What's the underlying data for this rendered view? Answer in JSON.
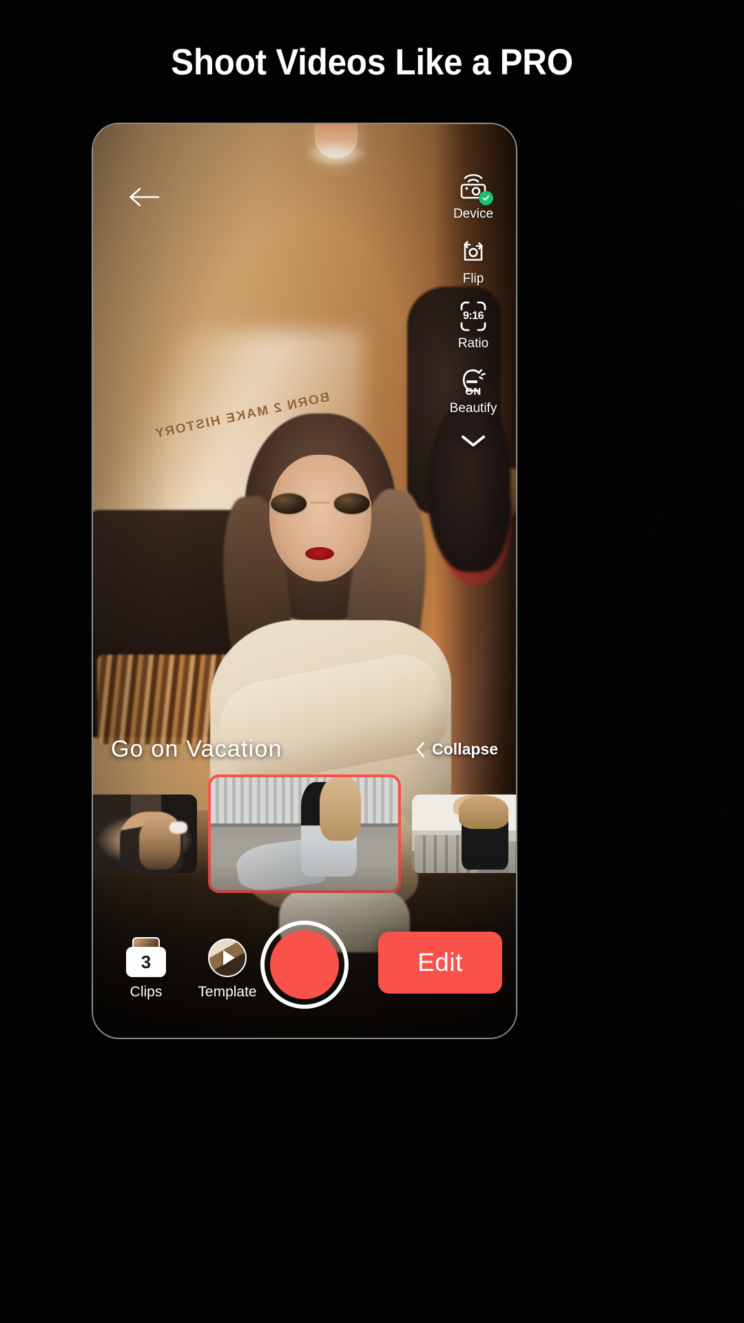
{
  "headline": "Shoot Videos Like a PRO",
  "phone": {
    "back_icon": "back-arrow-icon",
    "rail": [
      {
        "icon": "camera-device-icon",
        "label": "Device",
        "badge": "check-badge",
        "state": "connected"
      },
      {
        "icon": "camera-flip-icon",
        "label": "Flip"
      },
      {
        "icon": "aspect-ratio-icon",
        "label": "Ratio",
        "value": "9:16"
      },
      {
        "icon": "beautify-face-icon",
        "label": "Beautify",
        "value": "ON"
      }
    ],
    "rail_collapse_icon": "chevron-down-icon",
    "template": {
      "title": "Go on Vacation",
      "collapse_label": "Collapse",
      "collapse_icon": "chevron-left-icon",
      "thumbnails": [
        {
          "name": "clip-thumbnail-1",
          "selected": false
        },
        {
          "name": "clip-thumbnail-2",
          "selected": true
        },
        {
          "name": "clip-thumbnail-3",
          "selected": false
        }
      ]
    },
    "bottom_bar": {
      "clips": {
        "label": "Clips",
        "count": "3",
        "icon": "clips-stack-icon"
      },
      "template": {
        "label": "Template",
        "icon": "template-play-icon"
      },
      "record": {
        "name": "record-button",
        "icon": "record-circle-icon"
      },
      "edit": {
        "label": "Edit"
      }
    },
    "preview_overlay_text": "BORN 2 MAKE HISTORY"
  },
  "colors": {
    "accent_red": "#F8524B",
    "badge_green": "#1BBE6E",
    "background": "#000000",
    "text_primary": "#FFFFFF"
  }
}
